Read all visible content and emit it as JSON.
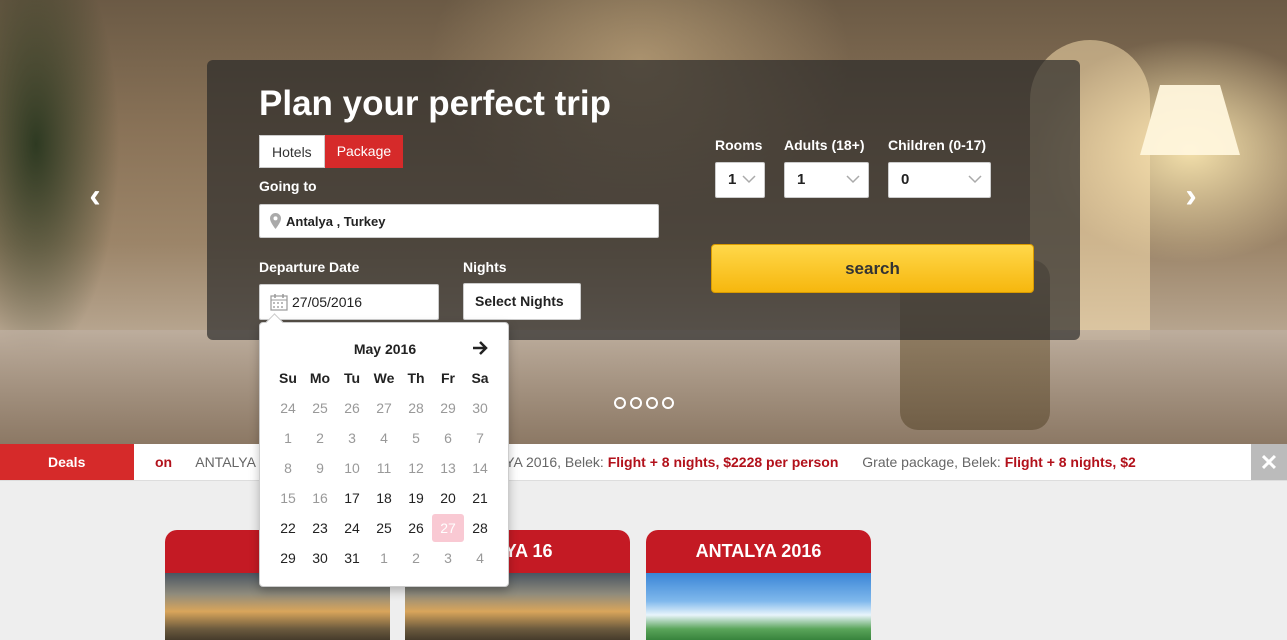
{
  "hero": {
    "title": "Plan your perfect trip",
    "tabs": [
      "Hotels",
      "Package"
    ],
    "active_tab": "Package",
    "going_to_label": "Going to",
    "going_to_value": "Antalya , Turkey",
    "departure_label": "Departure Date",
    "departure_value": "27/05/2016",
    "nights_label": "Nights",
    "nights_value": "Select Nights",
    "rooms_label": "Rooms",
    "rooms_value": "1",
    "adults_label": "Adults (18+)",
    "adults_value": "1",
    "children_label": "Children (0-17)",
    "children_value": "0",
    "search_label": "search",
    "slides_count": 4
  },
  "calendar": {
    "month_label": "May 2016",
    "weekdays": [
      "Su",
      "Mo",
      "Tu",
      "We",
      "Th",
      "Fr",
      "Sa"
    ],
    "weeks": [
      [
        {
          "d": "24",
          "m": true
        },
        {
          "d": "25",
          "m": true
        },
        {
          "d": "26",
          "m": true
        },
        {
          "d": "27",
          "m": true
        },
        {
          "d": "28",
          "m": true
        },
        {
          "d": "29",
          "m": true
        },
        {
          "d": "30",
          "m": true
        }
      ],
      [
        {
          "d": "1",
          "m": true
        },
        {
          "d": "2",
          "m": true
        },
        {
          "d": "3",
          "m": true
        },
        {
          "d": "4",
          "m": true
        },
        {
          "d": "5",
          "m": true
        },
        {
          "d": "6",
          "m": true
        },
        {
          "d": "7",
          "m": true
        }
      ],
      [
        {
          "d": "8",
          "m": true
        },
        {
          "d": "9",
          "m": true
        },
        {
          "d": "10",
          "m": true
        },
        {
          "d": "11",
          "m": true
        },
        {
          "d": "12",
          "m": true
        },
        {
          "d": "13",
          "m": true
        },
        {
          "d": "14",
          "m": true
        }
      ],
      [
        {
          "d": "15",
          "m": true
        },
        {
          "d": "16",
          "m": true
        },
        {
          "d": "17",
          "m": false
        },
        {
          "d": "18",
          "m": false
        },
        {
          "d": "19",
          "m": false
        },
        {
          "d": "20",
          "m": false
        },
        {
          "d": "21",
          "m": false
        }
      ],
      [
        {
          "d": "22",
          "m": false
        },
        {
          "d": "23",
          "m": false
        },
        {
          "d": "24",
          "m": false
        },
        {
          "d": "25",
          "m": false
        },
        {
          "d": "26",
          "m": false
        },
        {
          "d": "27",
          "m": false,
          "sel": true
        },
        {
          "d": "28",
          "m": false
        }
      ],
      [
        {
          "d": "29",
          "m": false
        },
        {
          "d": "30",
          "m": false
        },
        {
          "d": "31",
          "m": false
        },
        {
          "d": "1",
          "m": true
        },
        {
          "d": "2",
          "m": true
        },
        {
          "d": "3",
          "m": true
        },
        {
          "d": "4",
          "m": true
        }
      ]
    ]
  },
  "deals": {
    "label": "Deals",
    "items": [
      {
        "place": "",
        "offer": "on"
      },
      {
        "place": "ANTALYA 1",
        "offer": ""
      },
      {
        "place": "",
        "offer": "rson"
      },
      {
        "place": "ANTALYA 2016, Belek: ",
        "offer": "Flight + 8 nights, $2228 per person"
      },
      {
        "place": "Grate package, Belek: ",
        "offer": "Flight + 8 nights, $2"
      }
    ],
    "close_icon": "close-icon"
  },
  "cards": [
    {
      "title": "KRE",
      "image": "sunset-lighthouse"
    },
    {
      "title": "ALYA 16",
      "image": "sunset-lighthouse"
    },
    {
      "title": "ANTALYA 2016",
      "image": "beach-palms"
    }
  ],
  "colors": {
    "brand_red": "#d62a2a",
    "card_red": "#c41a24",
    "search_yellow": "#f6b70e",
    "offer_red": "#b2111b",
    "selected_day": "#f9c9d3"
  }
}
